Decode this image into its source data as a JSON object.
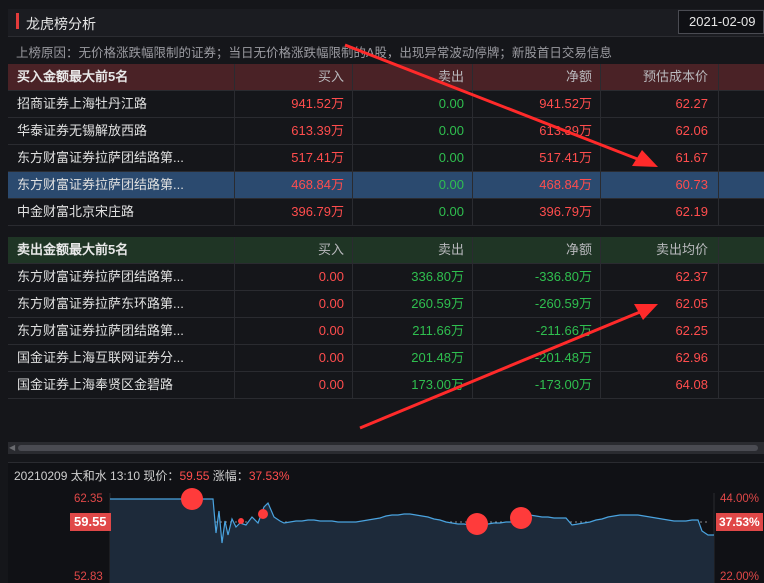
{
  "panel": {
    "title": "龙虎榜分析",
    "date": "2021-02-09"
  },
  "reason": "上榜原因：无价格涨跌幅限制的证券；当日无价格涨跌幅限制的A股，出现异常波动停牌；新股首日交易信息",
  "buy_table": {
    "headers": {
      "name": "买入金额最大前5名",
      "buy": "买入",
      "sell": "卖出",
      "net": "净额",
      "cost": "预估成本价"
    },
    "rows": [
      {
        "name": "招商证券上海牡丹江路",
        "buy": "941.52万",
        "sell": "0.00",
        "net": "941.52万",
        "cost": "62.27"
      },
      {
        "name": "华泰证券无锡解放西路",
        "buy": "613.39万",
        "sell": "0.00",
        "net": "613.39万",
        "cost": "62.06"
      },
      {
        "name": "东方财富证券拉萨团结路第...",
        "buy": "517.41万",
        "sell": "0.00",
        "net": "517.41万",
        "cost": "61.67"
      },
      {
        "name": "东方财富证券拉萨团结路第...",
        "buy": "468.84万",
        "sell": "0.00",
        "net": "468.84万",
        "cost": "60.73"
      },
      {
        "name": "中金财富北京宋庄路",
        "buy": "396.79万",
        "sell": "0.00",
        "net": "396.79万",
        "cost": "62.19"
      }
    ]
  },
  "sell_table": {
    "headers": {
      "name": "卖出金额最大前5名",
      "buy": "买入",
      "sell": "卖出",
      "net": "净额",
      "cost": "卖出均价"
    },
    "rows": [
      {
        "name": "东方财富证券拉萨团结路第...",
        "buy": "0.00",
        "sell": "336.80万",
        "net": "-336.80万",
        "cost": "62.37"
      },
      {
        "name": "东方财富证券拉萨东环路第...",
        "buy": "0.00",
        "sell": "260.59万",
        "net": "-260.59万",
        "cost": "62.05"
      },
      {
        "name": "东方财富证券拉萨团结路第...",
        "buy": "0.00",
        "sell": "211.66万",
        "net": "-211.66万",
        "cost": "62.25"
      },
      {
        "name": "国金证券上海互联网证券分...",
        "buy": "0.00",
        "sell": "201.48万",
        "net": "-201.48万",
        "cost": "62.96"
      },
      {
        "name": "国金证券上海奉贤区金碧路",
        "buy": "0.00",
        "sell": "173.00万",
        "net": "-173.00万",
        "cost": "64.08"
      }
    ]
  },
  "chart": {
    "header_prefix": "20210209 太和水 13:10 现价：",
    "price": "59.55",
    "change_label": " 涨幅：",
    "change": "37.53%",
    "left_top": "62.35",
    "left_bottom": "52.83",
    "right_top": "44.00%",
    "right_bottom": "22.00%",
    "current_price_tag": "59.55",
    "current_pct_tag": "37.53%",
    "colors": {
      "line": "#4aa3df",
      "marker": "#ff3b3b",
      "up": "#e04848",
      "fill": "#1d2a3a"
    }
  },
  "selected_buy_row": 3
}
